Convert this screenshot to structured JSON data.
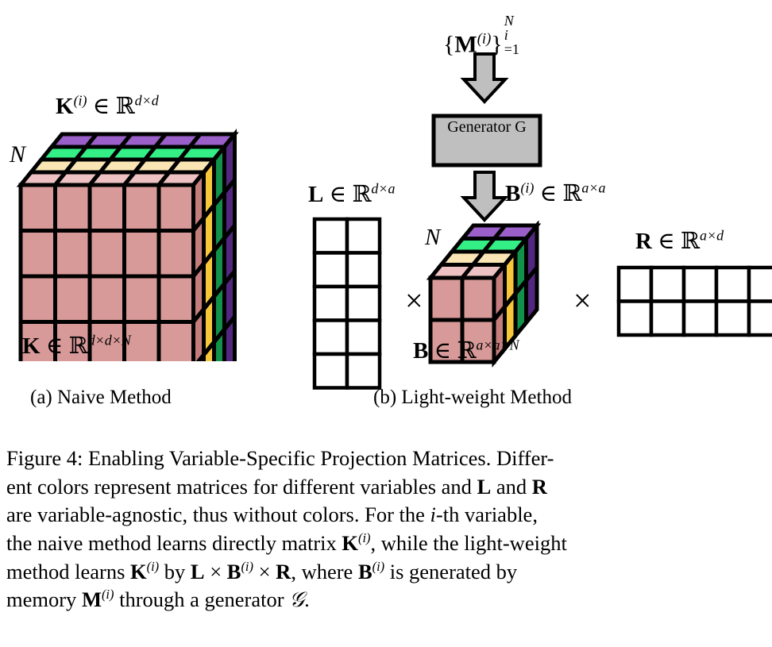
{
  "figure": {
    "number": "Figure 4",
    "title": "Enabling Variable-Specific Projection Matrices.",
    "caption_lines": [
      "Figure 4: Enabling Variable-Specific Projection Matrices.  Differ-",
      "ent colors represent matrices for different variables and L and R",
      "are variable-agnostic, thus without colors.   For the i-th variable,",
      "the naive method learns directly matrix K(i), while the light-weight",
      "method learns K(i) by L × B(i) × R, where B(i) is generated by",
      "memory M(i) through a generator G."
    ],
    "caption_full": "Figure 4: Enabling Variable-Specific Projection Matrices. Different colors represent matrices for different variables and L and R are variable-agnostic, thus without colors. For the i-th variable, the naive method learns directly matrix K(i), while the light-weight method learns K(i) by L × B(i) × R, where B(i) is generated by memory M(i) through a generator G."
  },
  "panels": {
    "a": {
      "subcaption": "(a) Naive Method",
      "top_label": "K(i) ∈ R^{d×d}",
      "bottom_label": "K ∈ R^{d×d×N}",
      "depth_label": "N",
      "cube": {
        "cols": 5,
        "rows": 5,
        "layers": 4
      }
    },
    "b": {
      "subcaption": "(b) Light-weight Method",
      "memory_label": "{M(i)}_{i=1}^{N}",
      "generator_line1": "Generator",
      "generator_line2": "G",
      "left_matrix_label": "L ∈ R^{d×a}",
      "core_label_top": "B(i) ∈ R^{a×a}",
      "core_label_bottom": "B ∈ R^{a×a×N}",
      "core_depth_label": "N",
      "right_matrix_label": "R ∈ R^{a×d}",
      "multiply_symbol": "×",
      "left_matrix": {
        "rows": 5,
        "cols": 2
      },
      "right_matrix": {
        "rows": 2,
        "cols": 5
      },
      "core_cube": {
        "cols": 2,
        "rows": 2,
        "layers": 4
      }
    }
  },
  "symbols": {
    "K": "K",
    "B": "B",
    "L": "L",
    "R": "R",
    "M": "M",
    "N": "N",
    "G_script": "𝒢",
    "G_plain": "G",
    "in": "∈",
    "reals": "ℝ",
    "sup_i": "(i)",
    "dim_dd": "d×d",
    "dim_ddN": "d×d×N",
    "dim_da": "d×a",
    "dim_aa": "a×a",
    "dim_aaN": "a×a×N",
    "dim_ad": "a×d"
  },
  "colors": {
    "layer1_front": "#d89a99",
    "layer1_top": "#eec2c2",
    "layer1_side": "#c47d7c",
    "layer2_front": "#f8de9a",
    "layer2_top": "#f9e6b4",
    "layer2_side": "#f7c73b",
    "layer3_front": "#2fe87c",
    "layer3_top": "#33ef85",
    "layer3_side": "#119149",
    "layer4_front": "#9a5fc8",
    "layer4_top": "#9a5fc8",
    "layer4_side": "#53277f",
    "generator_fill": "#bfbfbf",
    "arrow_fill": "#bfbfbf",
    "outline": "#000000",
    "matrix_fill": "#ffffff",
    "background": "#ffffff"
  }
}
